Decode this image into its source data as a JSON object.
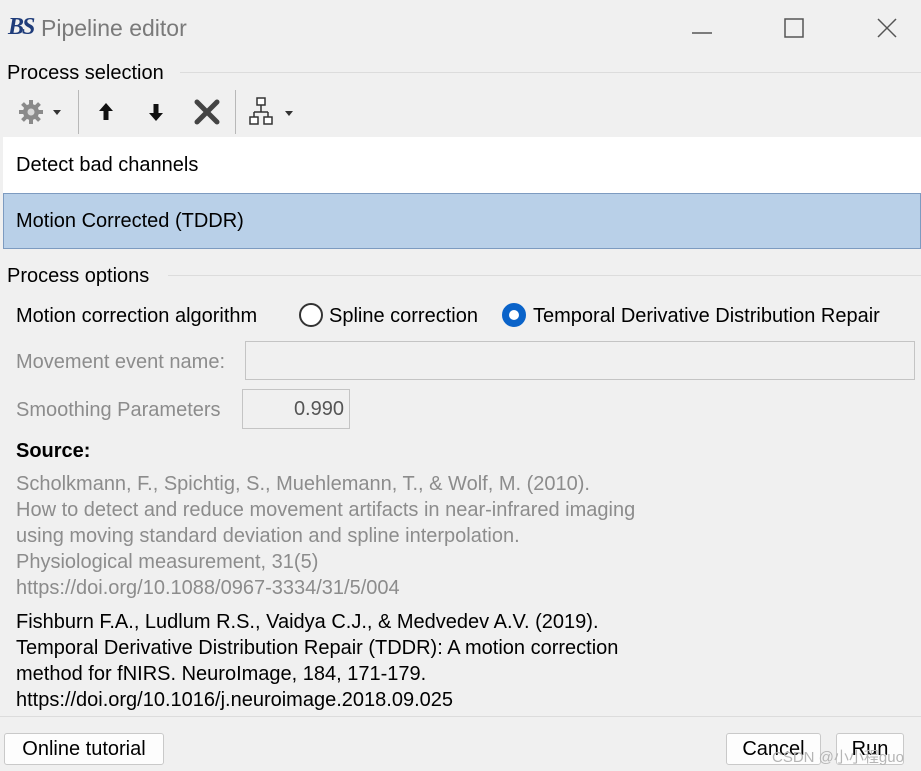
{
  "window": {
    "logo_text": "BS",
    "title": "Pipeline editor",
    "minimize_icon": "minimize-icon",
    "maximize_icon": "maximize-icon",
    "close_icon": "close-icon"
  },
  "process_selection": {
    "label": "Process selection",
    "toolbar": [
      {
        "name": "settings-dropdown",
        "icon": "gear-icon"
      },
      {
        "name": "move-up",
        "icon": "arrow-up-icon"
      },
      {
        "name": "move-down",
        "icon": "arrow-down-icon"
      },
      {
        "name": "delete",
        "icon": "delete-x-icon"
      },
      {
        "name": "pipeline-dropdown",
        "icon": "tree-icon"
      }
    ],
    "items": [
      {
        "label": "Detect bad channels",
        "selected": false
      },
      {
        "label": "Motion Corrected (TDDR)",
        "selected": true
      }
    ]
  },
  "process_options": {
    "label": "Process options",
    "algorithm": {
      "label": "Motion correction algorithm",
      "options": [
        {
          "label": "Spline correction",
          "checked": false
        },
        {
          "label": "Temporal Derivative Distribution Repair",
          "checked": true
        }
      ]
    },
    "movement_event": {
      "label": "Movement event name:",
      "value": ""
    },
    "smoothing": {
      "label": "Smoothing Parameters",
      "value": "0.990"
    },
    "source": {
      "heading": "Source:",
      "ref1": [
        "Scholkmann, F., Spichtig, S., Muehlemann, T., & Wolf, M. (2010).",
        "How to detect and reduce movement artifacts in near-infrared imaging",
        "using moving standard deviation and spline interpolation.",
        "Physiological measurement, 31(5)",
        "https://doi.org/10.1088/0967-3334/31/5/004"
      ],
      "ref2": [
        "Fishburn F.A., Ludlum R.S., Vaidya C.J., & Medvedev A.V. (2019).",
        "Temporal Derivative Distribution Repair (TDDR): A motion correction",
        "method for fNIRS. NeuroImage, 184, 171-179.",
        "https://doi.org/10.1016/j.neuroimage.2018.09.025"
      ]
    }
  },
  "footer": {
    "online_tutorial": "Online tutorial",
    "cancel": "Cancel",
    "run": "Run",
    "watermark": "CSDN @小小程guo"
  },
  "colors": {
    "selection_bg": "#b9d0e8",
    "radio_accent": "#0a63c9",
    "disabled_text": "#8c8c8c"
  }
}
